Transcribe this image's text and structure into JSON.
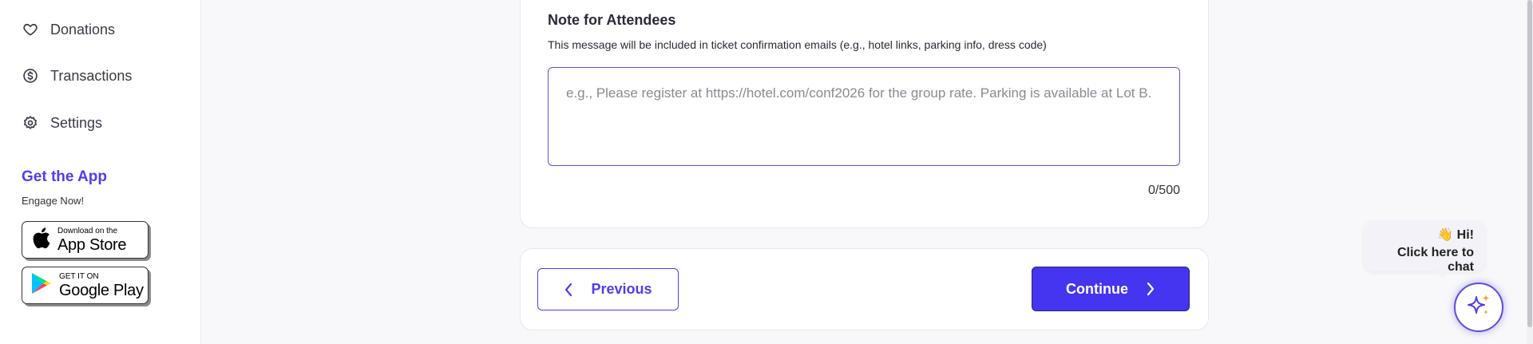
{
  "sidebar": {
    "items": [
      {
        "label": "Donations",
        "icon": "heart-icon"
      },
      {
        "label": "Transactions",
        "icon": "dollar-circle-icon"
      },
      {
        "label": "Settings",
        "icon": "gear-icon"
      }
    ],
    "get_app": {
      "title": "Get the App",
      "subtitle": "Engage Now!",
      "app_store": {
        "small": "Download on the",
        "big": "App Store"
      },
      "google_play": {
        "small": "GET IT ON",
        "big": "Google Play"
      }
    }
  },
  "note": {
    "title": "Note for Attendees",
    "description": "This message will be included in ticket confirmation emails (e.g., hotel links, parking info, dress code)",
    "value": "",
    "placeholder": "e.g., Please register at https://hotel.com/conf2026 for the group rate. Parking is available at Lot B.",
    "char_count": "0/500"
  },
  "navigation": {
    "previous_label": "Previous",
    "continue_label": "Continue"
  },
  "chat": {
    "greeting": "👋 Hi!",
    "prompt": "Click here to chat"
  },
  "colors": {
    "accent": "#4f3df0",
    "continue_bg": "#4535f0",
    "sparkle_gold": "#f2a93b"
  }
}
